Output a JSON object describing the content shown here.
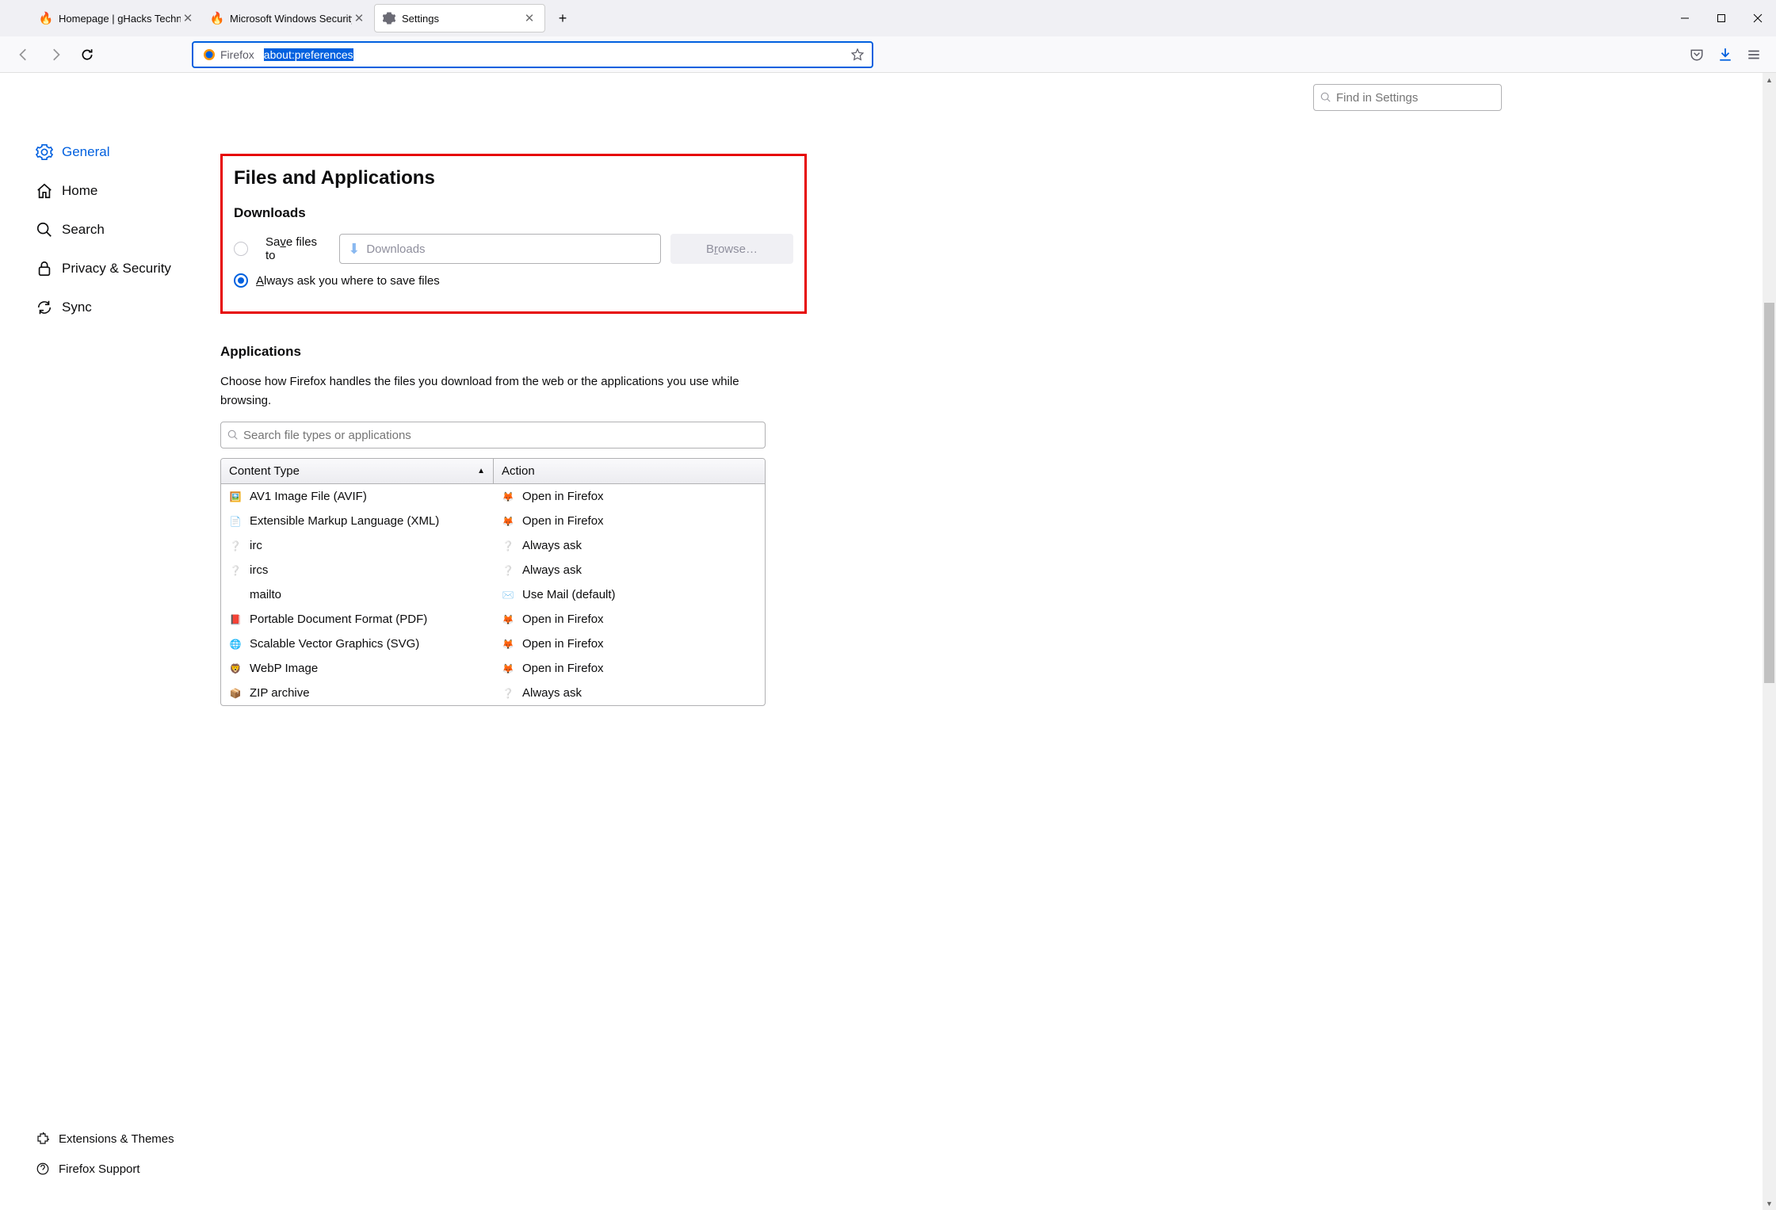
{
  "tabs": [
    {
      "title": "Homepage | gHacks Technology",
      "favicon": "ghacks"
    },
    {
      "title": "Microsoft Windows Security Up",
      "favicon": "ghacks"
    },
    {
      "title": "Settings",
      "favicon": "gear",
      "active": true
    }
  ],
  "url": {
    "identity_label": "Firefox",
    "value": "about:preferences"
  },
  "find_placeholder": "Find in Settings",
  "sidebar": {
    "items": [
      {
        "label": "General",
        "icon": "gear",
        "active": true
      },
      {
        "label": "Home",
        "icon": "home"
      },
      {
        "label": "Search",
        "icon": "search"
      },
      {
        "label": "Privacy & Security",
        "icon": "lock"
      },
      {
        "label": "Sync",
        "icon": "sync"
      }
    ],
    "bottom": [
      {
        "label": "Extensions & Themes",
        "icon": "puzzle"
      },
      {
        "label": "Firefox Support",
        "icon": "help"
      }
    ]
  },
  "files_apps": {
    "heading": "Files and Applications",
    "downloads_heading": "Downloads",
    "save_label_pre": "Sa",
    "save_label_u": "v",
    "save_label_post": "e files to",
    "save_path": "Downloads",
    "browse_label": "Browse…",
    "always_label_u": "A",
    "always_label_post": "lways ask you where to save files"
  },
  "applications": {
    "heading": "Applications",
    "description": "Choose how Firefox handles the files you download from the web or the applications you use while browsing.",
    "search_placeholder": "Search file types or applications",
    "col_type": "Content Type",
    "col_action": "Action",
    "rows": [
      {
        "type": "AV1 Image File (AVIF)",
        "icon": "img",
        "action": "Open in Firefox",
        "aicon": "ff"
      },
      {
        "type": "Extensible Markup Language (XML)",
        "icon": "xml",
        "action": "Open in Firefox",
        "aicon": "ff"
      },
      {
        "type": "irc",
        "icon": "ask",
        "action": "Always ask",
        "aicon": "ask"
      },
      {
        "type": "ircs",
        "icon": "ask",
        "action": "Always ask",
        "aicon": "ask"
      },
      {
        "type": "mailto",
        "icon": "",
        "action": "Use Mail (default)",
        "aicon": "mail"
      },
      {
        "type": "Portable Document Format (PDF)",
        "icon": "pdf",
        "action": "Open in Firefox",
        "aicon": "ff"
      },
      {
        "type": "Scalable Vector Graphics (SVG)",
        "icon": "edge",
        "action": "Open in Firefox",
        "aicon": "ff"
      },
      {
        "type": "WebP Image",
        "icon": "brave",
        "action": "Open in Firefox",
        "aicon": "ff"
      },
      {
        "type": "ZIP archive",
        "icon": "zip",
        "action": "Always ask",
        "aicon": "ask"
      }
    ]
  }
}
